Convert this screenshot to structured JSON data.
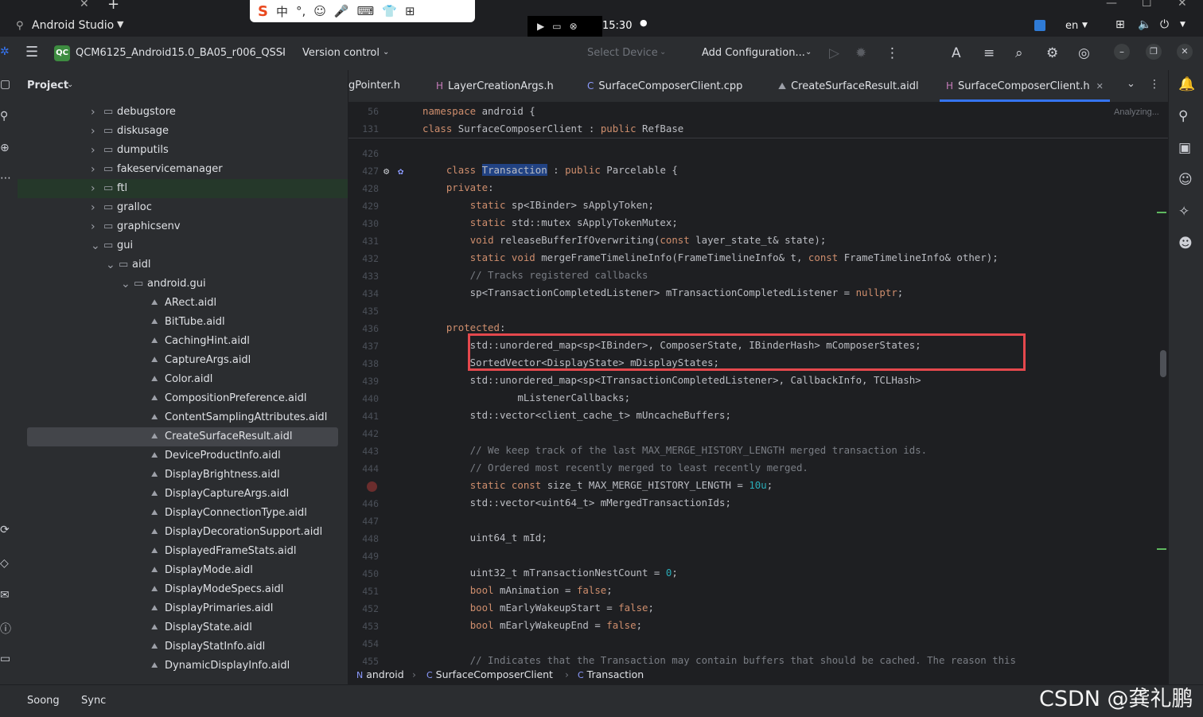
{
  "os": {
    "app_title": "Android Studio",
    "clock": "15:30",
    "lang": "en"
  },
  "ime": {
    "logo": "S",
    "items": [
      "中",
      "°,",
      "☺",
      "🎤",
      "⌨",
      "👕",
      "⊞"
    ]
  },
  "toolbar": {
    "project_badge": "QC",
    "project_name": "QCM6125_Android15.0_BA05_r006_QSSI",
    "version_control": "Version control",
    "select_device": "Select Device",
    "add_configuration": "Add Configuration..."
  },
  "project_panel": {
    "title": "Project",
    "rows": [
      {
        "name": "debugstore",
        "depth": 0,
        "kind": "folder",
        "arrow": "›"
      },
      {
        "name": "diskusage",
        "depth": 0,
        "kind": "folder",
        "arrow": "›"
      },
      {
        "name": "dumputils",
        "depth": 0,
        "kind": "folder",
        "arrow": "›"
      },
      {
        "name": "fakeservicemanager",
        "depth": 0,
        "kind": "folder",
        "arrow": "›"
      },
      {
        "name": "ftl",
        "depth": 0,
        "kind": "folder",
        "arrow": "›",
        "hl": true
      },
      {
        "name": "gralloc",
        "depth": 0,
        "kind": "folder",
        "arrow": "›"
      },
      {
        "name": "graphicsenv",
        "depth": 0,
        "kind": "folder",
        "arrow": "›"
      },
      {
        "name": "gui",
        "depth": 0,
        "kind": "folder",
        "arrow": "⌄"
      },
      {
        "name": "aidl",
        "depth": 1,
        "kind": "folder",
        "arrow": "⌄"
      },
      {
        "name": "android.gui",
        "depth": 2,
        "kind": "folder",
        "arrow": "⌄"
      },
      {
        "name": "ARect.aidl",
        "depth": 3,
        "kind": "aidl"
      },
      {
        "name": "BitTube.aidl",
        "depth": 3,
        "kind": "aidl"
      },
      {
        "name": "CachingHint.aidl",
        "depth": 3,
        "kind": "aidl"
      },
      {
        "name": "CaptureArgs.aidl",
        "depth": 3,
        "kind": "aidl"
      },
      {
        "name": "Color.aidl",
        "depth": 3,
        "kind": "aidl"
      },
      {
        "name": "CompositionPreference.aidl",
        "depth": 3,
        "kind": "aidl"
      },
      {
        "name": "ContentSamplingAttributes.aidl",
        "depth": 3,
        "kind": "aidl"
      },
      {
        "name": "CreateSurfaceResult.aidl",
        "depth": 3,
        "kind": "aidl",
        "selected": true
      },
      {
        "name": "DeviceProductInfo.aidl",
        "depth": 3,
        "kind": "aidl"
      },
      {
        "name": "DisplayBrightness.aidl",
        "depth": 3,
        "kind": "aidl"
      },
      {
        "name": "DisplayCaptureArgs.aidl",
        "depth": 3,
        "kind": "aidl"
      },
      {
        "name": "DisplayConnectionType.aidl",
        "depth": 3,
        "kind": "aidl"
      },
      {
        "name": "DisplayDecorationSupport.aidl",
        "depth": 3,
        "kind": "aidl"
      },
      {
        "name": "DisplayedFrameStats.aidl",
        "depth": 3,
        "kind": "aidl"
      },
      {
        "name": "DisplayMode.aidl",
        "depth": 3,
        "kind": "aidl"
      },
      {
        "name": "DisplayModeSpecs.aidl",
        "depth": 3,
        "kind": "aidl"
      },
      {
        "name": "DisplayPrimaries.aidl",
        "depth": 3,
        "kind": "aidl"
      },
      {
        "name": "DisplayState.aidl",
        "depth": 3,
        "kind": "aidl"
      },
      {
        "name": "DisplayStatInfo.aidl",
        "depth": 3,
        "kind": "aidl"
      },
      {
        "name": "DynamicDisplayInfo.aidl",
        "depth": 3,
        "kind": "aidl"
      }
    ]
  },
  "tabs": [
    {
      "label": "gPointer.h",
      "icon": ""
    },
    {
      "label": "LayerCreationArgs.h",
      "icon": "H"
    },
    {
      "label": "SurfaceComposerClient.cpp",
      "icon": "C"
    },
    {
      "label": "CreateSurfaceResult.aidl",
      "icon": "⛰"
    },
    {
      "label": "SurfaceComposerClient.h",
      "icon": "H",
      "active": true
    }
  ],
  "editor": {
    "analyzing": "Analyzing...",
    "sticky": [
      {
        "ln": "56",
        "code": "namespace android {"
      },
      {
        "ln": "131",
        "code": "class SurfaceComposerClient : public RefBase"
      }
    ],
    "lines": [
      {
        "ln": "426",
        "code": ""
      },
      {
        "ln": "427",
        "code": "    class Transaction : public Parcelable {"
      },
      {
        "ln": "428",
        "code": "    private:"
      },
      {
        "ln": "429",
        "code": "        static sp<IBinder> sApplyToken;"
      },
      {
        "ln": "430",
        "code": "        static std::mutex sApplyTokenMutex;"
      },
      {
        "ln": "431",
        "code": "        void releaseBufferIfOverwriting(const layer_state_t& state);"
      },
      {
        "ln": "432",
        "code": "        static void mergeFrameTimelineInfo(FrameTimelineInfo& t, const FrameTimelineInfo& other);"
      },
      {
        "ln": "433",
        "code": "        // Tracks registered callbacks"
      },
      {
        "ln": "434",
        "code": "        sp<TransactionCompletedListener> mTransactionCompletedListener = nullptr;"
      },
      {
        "ln": "435",
        "code": ""
      },
      {
        "ln": "436",
        "code": "    protected:"
      },
      {
        "ln": "437",
        "code": "        std::unordered_map<sp<IBinder>, ComposerState, IBinderHash> mComposerStates;"
      },
      {
        "ln": "438",
        "code": "        SortedVector<DisplayState> mDisplayStates;"
      },
      {
        "ln": "439",
        "code": "        std::unordered_map<sp<ITransactionCompletedListener>, CallbackInfo, TCLHash>"
      },
      {
        "ln": "440",
        "code": "                mListenerCallbacks;"
      },
      {
        "ln": "441",
        "code": "        std::vector<client_cache_t> mUncacheBuffers;"
      },
      {
        "ln": "442",
        "code": ""
      },
      {
        "ln": "443",
        "code": "        // We keep track of the last MAX_MERGE_HISTORY_LENGTH merged transaction ids."
      },
      {
        "ln": "444",
        "code": "        // Ordered most recently merged to least recently merged."
      },
      {
        "ln": "",
        "code": "        static const size_t MAX_MERGE_HISTORY_LENGTH = 10u;"
      },
      {
        "ln": "446",
        "code": "        std::vector<uint64_t> mMergedTransactionIds;"
      },
      {
        "ln": "447",
        "code": ""
      },
      {
        "ln": "448",
        "code": "        uint64_t mId;"
      },
      {
        "ln": "449",
        "code": ""
      },
      {
        "ln": "450",
        "code": "        uint32_t mTransactionNestCount = 0;"
      },
      {
        "ln": "451",
        "code": "        bool mAnimation = false;"
      },
      {
        "ln": "452",
        "code": "        bool mEarlyWakeupStart = false;"
      },
      {
        "ln": "453",
        "code": "        bool mEarlyWakeupEnd = false;"
      },
      {
        "ln": "454",
        "code": ""
      },
      {
        "ln": "455",
        "code": "        // Indicates that the Transaction may contain buffers that should be cached. The reason this"
      }
    ]
  },
  "breadcrumb": [
    {
      "label": "android",
      "icon": "N"
    },
    {
      "label": "SurfaceComposerClient",
      "icon": "C"
    },
    {
      "label": "Transaction",
      "icon": "C"
    }
  ],
  "bottom_tabs": [
    "Soong",
    "Sync"
  ],
  "watermark": "CSDN @龚礼鹏",
  "colors": {
    "accent": "#3574f0",
    "highlight_box": "#e5484d",
    "keyword": "#cf8e6d",
    "comment": "#7a7e85"
  }
}
